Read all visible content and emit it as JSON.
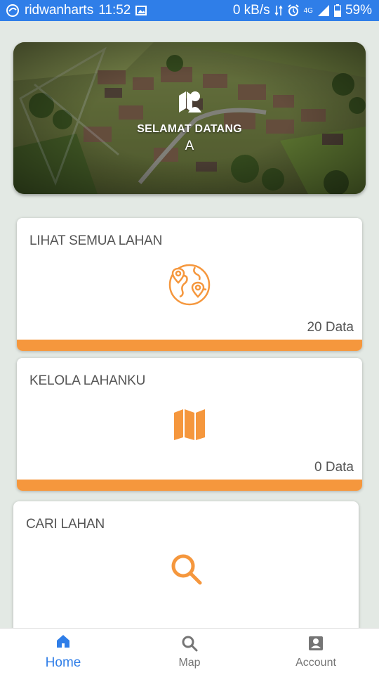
{
  "status_bar": {
    "carrier": "ridwanharts",
    "time": "11:52",
    "speed": "0 kB/s",
    "network": "4G",
    "battery": "59%"
  },
  "hero": {
    "title": "SELAMAT DATANG",
    "name": "A"
  },
  "cards": [
    {
      "title": "LIHAT SEMUA LAHAN",
      "count": "20 Data",
      "icon": "globe-pin-icon"
    },
    {
      "title": "KELOLA LAHANKU",
      "count": "0 Data",
      "icon": "map-icon"
    },
    {
      "title": "CARI LAHAN",
      "icon": "search-icon"
    }
  ],
  "bottom_nav": [
    {
      "label": "Home",
      "icon": "home-icon",
      "active": true
    },
    {
      "label": "Map",
      "icon": "search-icon"
    },
    {
      "label": "Account",
      "icon": "account-icon"
    }
  ],
  "colors": {
    "accent": "#f5973d",
    "primary": "#2f7ee8",
    "background": "#e3e9e4"
  }
}
